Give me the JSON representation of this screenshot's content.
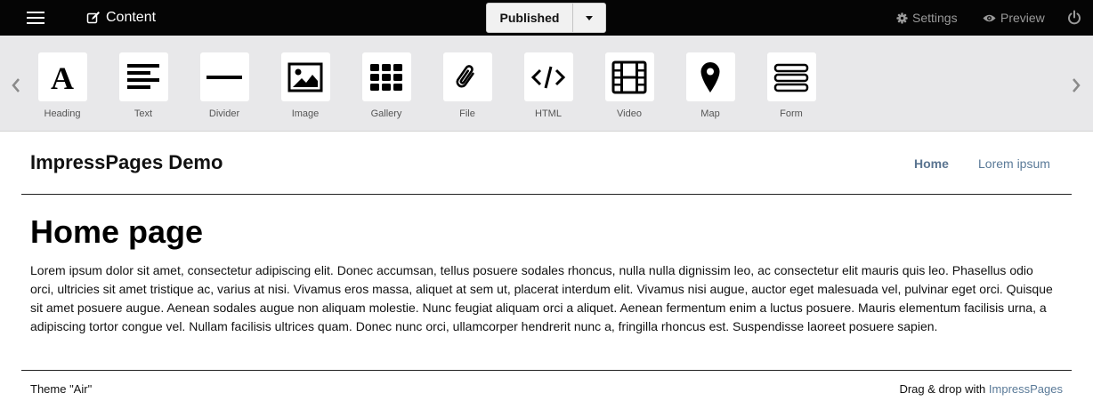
{
  "topbar": {
    "content_label": "Content",
    "publish_label": "Published",
    "settings_label": "Settings",
    "preview_label": "Preview",
    "icons": {
      "menu": "hamburger-icon",
      "content": "edit-icon",
      "publish_menu": "caret-down-icon",
      "settings": "gear-icon",
      "preview": "eye-icon",
      "logout": "power-icon"
    }
  },
  "toolbar": {
    "widgets": [
      {
        "label": "Heading",
        "icon": "heading-icon"
      },
      {
        "label": "Text",
        "icon": "text-icon"
      },
      {
        "label": "Divider",
        "icon": "divider-icon"
      },
      {
        "label": "Image",
        "icon": "image-icon"
      },
      {
        "label": "Gallery",
        "icon": "gallery-icon"
      },
      {
        "label": "File",
        "icon": "paperclip-icon"
      },
      {
        "label": "HTML",
        "icon": "code-icon"
      },
      {
        "label": "Video",
        "icon": "film-icon"
      },
      {
        "label": "Map",
        "icon": "map-marker-icon"
      },
      {
        "label": "Form",
        "icon": "form-icon"
      }
    ]
  },
  "site": {
    "title": "ImpressPages Demo",
    "nav": [
      {
        "label": "Home",
        "active": true
      },
      {
        "label": "Lorem ipsum",
        "active": false
      }
    ]
  },
  "page": {
    "heading": "Home page",
    "body": "Lorem ipsum dolor sit amet, consectetur adipiscing elit. Donec accumsan, tellus posuere sodales rhoncus, nulla nulla dignissim leo, ac consectetur elit mauris quis leo. Phasellus odio orci, ultricies sit amet tristique ac, varius at nisi. Vivamus eros massa, aliquet at sem ut, placerat interdum elit. Vivamus nisi augue, auctor eget malesuada vel, pulvinar eget orci. Quisque sit amet posuere augue. Aenean sodales augue non aliquam molestie. Nunc feugiat aliquam orci a aliquet. Aenean fermentum enim a luctus posuere. Mauris elementum facilisis urna, a adipiscing tortor congue vel. Nullam facilisis ultrices quam. Donec nunc orci, ullamcorper hendrerit nunc a, fringilla rhoncus est. Suspendisse laoreet posuere sapien."
  },
  "footer": {
    "theme": "Theme \"Air\"",
    "credit_prefix": "Drag & drop with ",
    "credit_link": "ImpressPages"
  },
  "colors": {
    "topbar_bg": "#050505",
    "toolbar_bg": "#e8e8ea",
    "link": "#5a7a98",
    "muted": "#9a9a9a"
  }
}
